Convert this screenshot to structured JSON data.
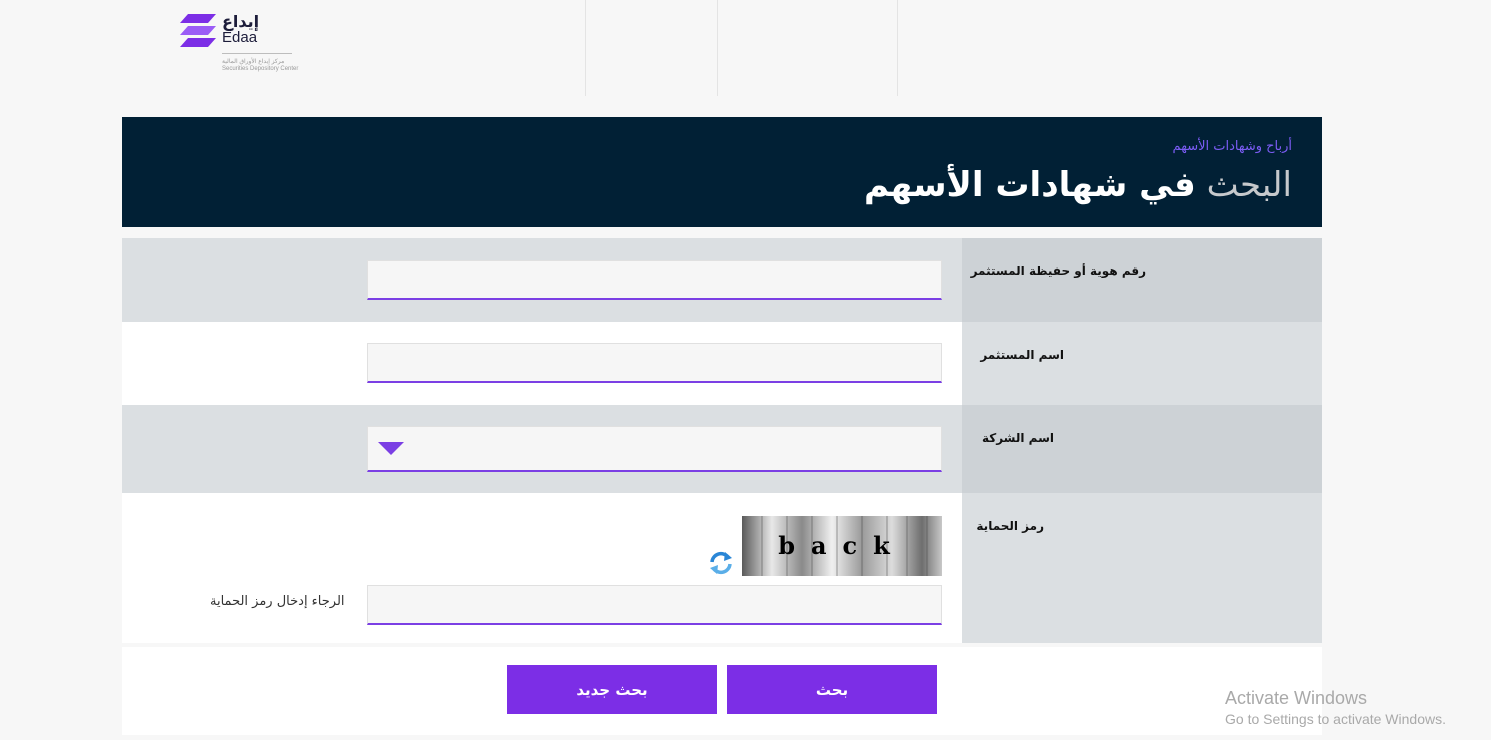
{
  "header": {
    "logo_ar": "إيداع",
    "logo_en": "Edaa",
    "logo_sub_1": "مركز إيداع الأوراق المالية",
    "logo_sub_2": "Securities Depository Center",
    "brand_color": "#7c2ee6",
    "logo_icon": "edaa-layers-icon"
  },
  "banner": {
    "breadcrumb": "أرباح وشهادات الأسهم",
    "title_light": "البحث",
    "title_bold": "في شهادات الأسهم",
    "background": "#012035"
  },
  "form": {
    "investor_id_label": "رقم هوية أو حفيظة المستثمر",
    "investor_id_value": "",
    "investor_name_label": "اسم المستثمر",
    "investor_name_value": "",
    "company_name_label": "اسم الشركة",
    "company_name_selected": "",
    "captcha_label": "رمز الحماية",
    "captcha_text": "back",
    "captcha_value": "",
    "captcha_note": "الرجاء إدخال رمز الحماية"
  },
  "buttons": {
    "search_label": "بحث",
    "new_search_label": "بحث جديد"
  },
  "watermark": {
    "line1": "Activate Windows",
    "line2": "Go to Settings to activate Windows."
  }
}
